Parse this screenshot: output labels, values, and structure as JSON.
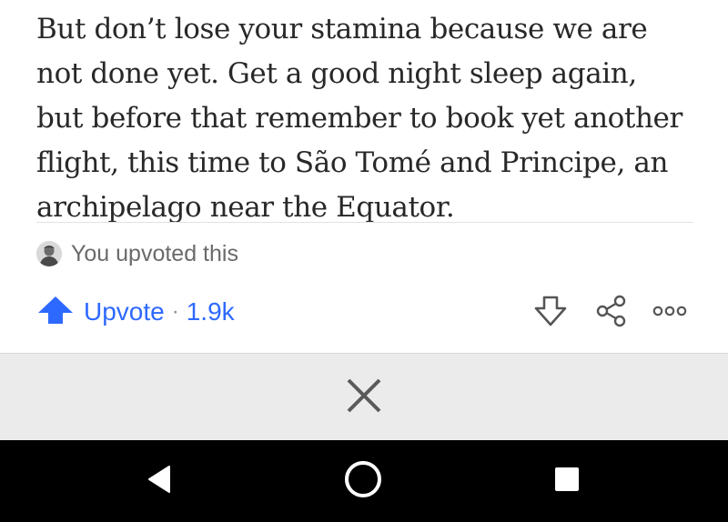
{
  "answer": {
    "lines": [
      "But don’t lose your stamina because we are",
      "not done yet. Get a good night sleep again,",
      "but before that remember to book yet another",
      "flight, this time to São Tomé and Principe, an",
      "archipelago near the Equator."
    ]
  },
  "upvote_status": {
    "text": "You upvoted this"
  },
  "actions": {
    "upvote_label": "Upvote",
    "separator": "·",
    "upvote_count": "1.9k",
    "upvote_icon": "arrow-up-icon",
    "downvote_icon": "arrow-down-outline-icon",
    "share_icon": "share-icon",
    "more_icon": "more-options-icon"
  },
  "dismiss": {
    "icon": "close-icon"
  },
  "navbar": {
    "back_icon": "back-triangle-icon",
    "home_icon": "home-circle-icon",
    "recents_icon": "recents-square-icon"
  },
  "colors": {
    "accent": "#2e69ff",
    "text": "#282829",
    "muted": "#6a6a6a",
    "dismiss_bg": "#ebebeb",
    "navbar_bg": "#000000"
  }
}
